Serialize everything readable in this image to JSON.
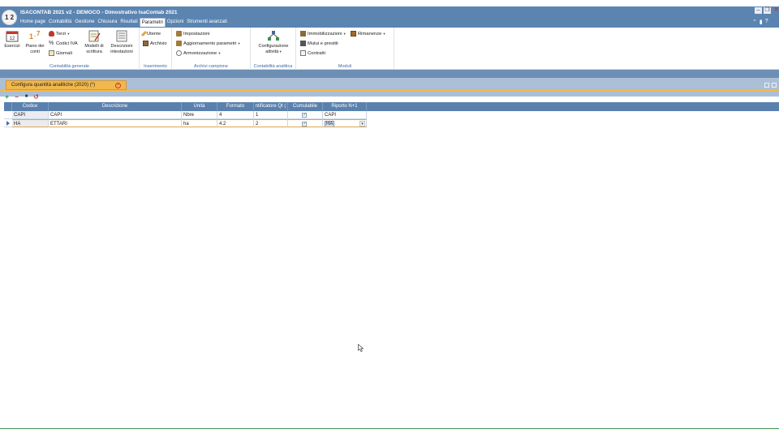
{
  "window": {
    "title": "ISACONTAB 2021 v2 - DEMOCO - Dimostrativo IsaContab 2021",
    "logo_text": "1 2",
    "min_label": "–",
    "max_label": "❐",
    "close_label": "✕"
  },
  "menu": {
    "tabs": [
      {
        "label": "Home page"
      },
      {
        "label": "Contabilità"
      },
      {
        "label": "Gestione"
      },
      {
        "label": "Chiusura"
      },
      {
        "label": "Risultati"
      },
      {
        "label": "Parametri"
      },
      {
        "label": "Opzioni"
      },
      {
        "label": "Strumenti avanzati"
      }
    ],
    "active_tab": "Parametri"
  },
  "ribbon": {
    "contabilita_generale": {
      "label": "Contabilità generale",
      "esercizi": "Esercizi",
      "piano_line1": "Piano  dei",
      "piano_line2": "conti",
      "terzi": "Terzi",
      "codici_iva": "Codici IVA",
      "giornali": "Giornali",
      "modelli_line1": "Modelli di",
      "modelli_line2": "scrittura",
      "descrizioni_line1": "Descrizioni",
      "descrizioni_line2": "intestazioni"
    },
    "inserimento": {
      "label": "Inserimento",
      "utente": "Utente",
      "archivio": "Archivio"
    },
    "archivi_campione": {
      "label": "Archivi campione",
      "impostazioni": "Impostazioni",
      "aggiornamento": "Aggiornamento parametri",
      "armonizzazione": "Armonizzazione"
    },
    "contabilita_analitica": {
      "label": "Contabilità analitica",
      "config_line1": "Configurazione",
      "config_line2": "attività"
    },
    "moduli": {
      "label": "Moduli",
      "immobilizzazioni": "Immobilizzazioni",
      "rimanenze": "Rimanenze",
      "mutui": "Mutui e prestiti",
      "contratti": "Contratti"
    }
  },
  "document_tab": {
    "title": "Configura quantità analitiche (2020) (*)",
    "close_glyph": "×"
  },
  "toolbar": {
    "add_glyph": "+",
    "remove_glyph": "−",
    "save_glyph": "■",
    "undo_glyph": "↺"
  },
  "grid": {
    "columns": [
      "Codice",
      "Descrizione",
      "Unità",
      "Formato",
      "ntificatore Qt (",
      "Cumulabile",
      "Riporto N+1"
    ],
    "rows": [
      {
        "codice": "CAPI",
        "descrizione": "CAPI",
        "unita": "Nbre",
        "formato": "4",
        "moltiplicatore": "1",
        "cumulabile": true,
        "riporto": "CAPI"
      },
      {
        "codice": "HA",
        "descrizione": "ETTARI",
        "unita": "ha",
        "formato": "4.2",
        "moltiplicatore": "2",
        "cumulabile": true,
        "riporto": "HA"
      }
    ],
    "check_glyph": "✓",
    "dropdown_glyph": "▾"
  },
  "colors": {
    "title_bar": "#5b84b1",
    "accent_tab": "#f2b84d",
    "grid_header": "#5a80ae",
    "group_label": "#3d6aa0"
  }
}
